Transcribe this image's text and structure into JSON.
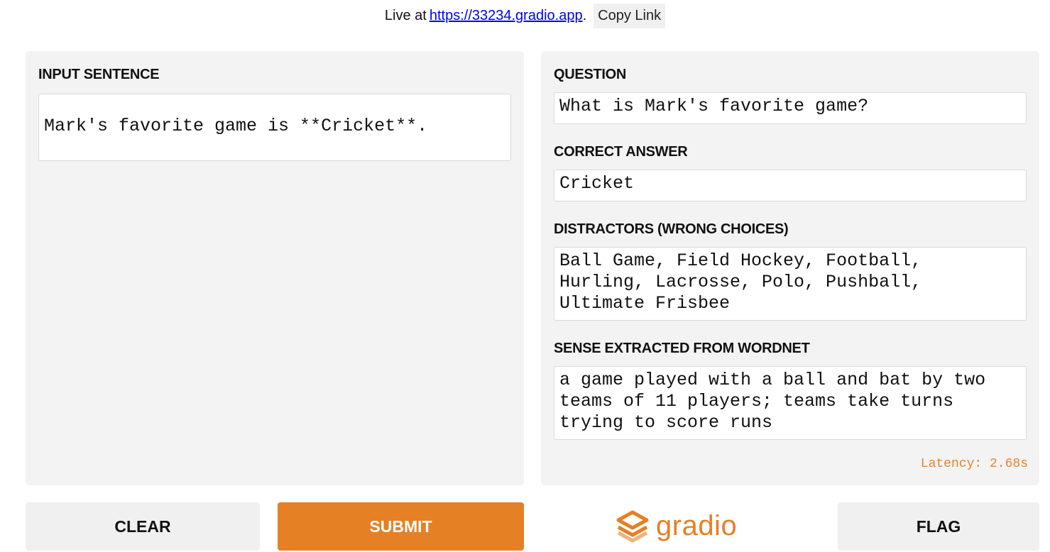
{
  "header": {
    "live_prefix": "Live at",
    "live_url": "https://33234.gradio.app",
    "period": ".",
    "copy_label": "Copy Link"
  },
  "input": {
    "label": "INPUT SENTENCE",
    "value": "Mark's favorite game is **Cricket**."
  },
  "output": {
    "question_label": "QUESTION",
    "question_value": "What is Mark's favorite game?",
    "answer_label": "CORRECT ANSWER",
    "answer_value": "Cricket",
    "distractors_label": "DISTRACTORS (WRONG CHOICES)",
    "distractors_value": "Ball Game, Field Hockey, Football,\nHurling, Lacrosse, Polo, Pushball,\nUltimate Frisbee",
    "sense_label": "SENSE EXTRACTED FROM WORDNET",
    "sense_value": "a game played with a ball and bat by two\nteams of 11 players; teams take turns\ntrying to score runs",
    "latency": "Latency: 2.68s"
  },
  "buttons": {
    "clear": "CLEAR",
    "submit": "SUBMIT",
    "flag": "FLAG"
  },
  "brand": {
    "name": "gradio",
    "color": "#e58024"
  }
}
